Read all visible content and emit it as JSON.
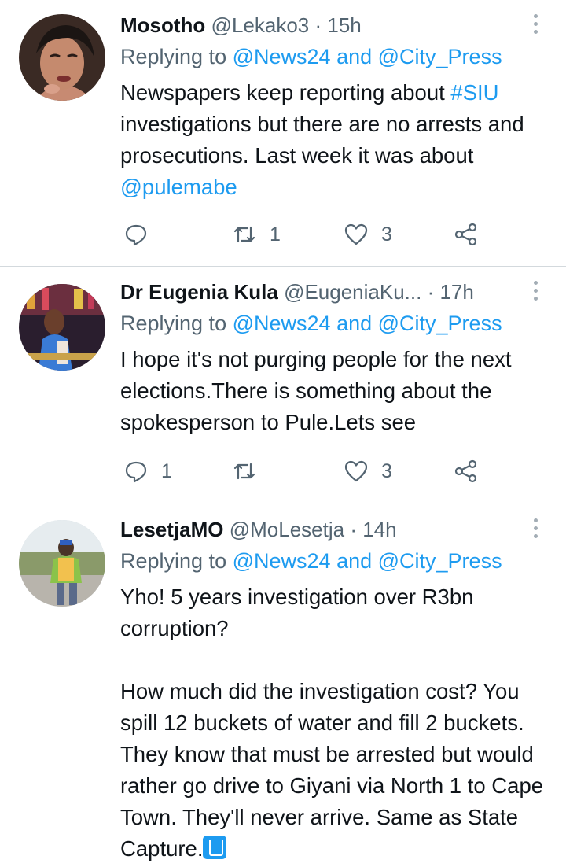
{
  "tweets": [
    {
      "name": "Mosotho",
      "handle": "@Lekako3",
      "time": "15h",
      "reply_prefix": "Replying to ",
      "reply_user1": "@News24",
      "reply_and": " and ",
      "reply_user2": "@City_Press",
      "text_main": "Newspapers keep reporting about ",
      "text_hashtag": "#SIU",
      "text_cont": " investigations but there are no arrests and prosecutions. Last week it was about ",
      "text_mention": "@pulemabe",
      "stats": {
        "replies": "",
        "retweets": "1",
        "likes": "3"
      }
    },
    {
      "name": "Dr Eugenia Kula",
      "handle": "@EugeniaKu...",
      "time": "17h",
      "reply_prefix": "Replying to ",
      "reply_user1": "@News24",
      "reply_and": " and ",
      "reply_user2": "@City_Press",
      "text": "I hope it's not purging people for the next elections.There is something about the spokesperson to Pule.Lets see",
      "stats": {
        "replies": "1",
        "retweets": "",
        "likes": "3"
      }
    },
    {
      "name": "LesetjaMO",
      "handle": "@MoLesetja",
      "time": "14h",
      "reply_prefix": "Replying to ",
      "reply_user1": "@News24",
      "reply_and": " and ",
      "reply_user2": "@City_Press",
      "text": "Yho! 5 years investigation over R3bn corruption?\n\nHow much did the investigation cost? You spill 12 buckets of water and fill 2 buckets. They know that must be arrested but would rather go drive to Giyani via North 1 to Cape Town. They'll never arrive. Same as State Capture.",
      "text_emoji": "put-litter-in-bin"
    }
  ],
  "separator": " · ",
  "colors": {
    "link": "#1d9bf0",
    "secondary": "#536471",
    "text": "#0f1419",
    "divider": "#d3d9dd"
  },
  "icons": [
    "reply-icon",
    "retweet-icon",
    "like-icon",
    "share-icon",
    "more-options-icon"
  ]
}
